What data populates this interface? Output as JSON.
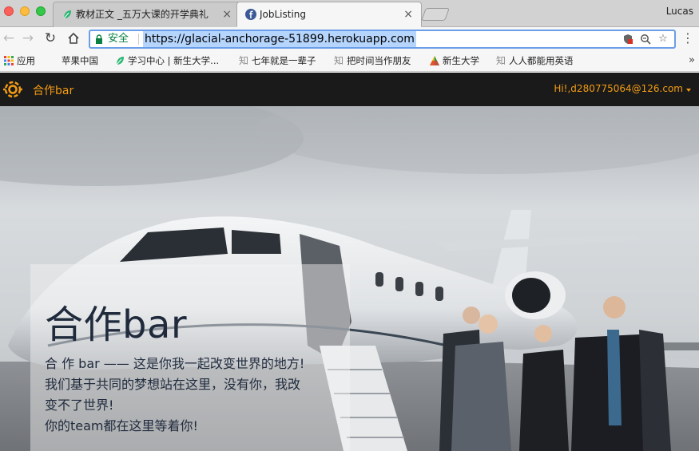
{
  "browser": {
    "tabs": [
      {
        "title": "教材正文 _五万大课的开学典礼 |",
        "close": "×",
        "active": false
      },
      {
        "title": "JobListing",
        "close": "×",
        "active": true
      }
    ],
    "profile_name": "Lucas",
    "security_label": "安全",
    "url": "https://glacial-anchorage-51899.herokuapp.com",
    "bookmarks": [
      {
        "label": "应用",
        "icon": "apps-grid-icon"
      },
      {
        "label": "苹果中国",
        "icon": "apple-icon"
      },
      {
        "label": "学习中心 | 新生大学...",
        "icon": "leaf-icon"
      },
      {
        "label": "七年就是一辈子",
        "icon": "zhihu-icon"
      },
      {
        "label": "把时间当作朋友",
        "icon": "zhihu-icon"
      },
      {
        "label": "新生大学",
        "icon": "triangle-logo-icon"
      },
      {
        "label": "人人都能用英语",
        "icon": "zhihu-icon"
      }
    ],
    "bookmarks_more": "»"
  },
  "app": {
    "brand": "合作bar",
    "user_menu": "Hi!,d280775064@126.com",
    "accent_color": "#f39c12",
    "navbar_color": "#1a1a1a"
  },
  "hero": {
    "title": "合作bar",
    "lines": [
      "合 作 bar —— 这是你我一起改变世界的地方!",
      "我们基于共同的梦想站在这里，没有你，我改",
      "变不了世界!",
      "你的team都在这里等着你!"
    ]
  }
}
